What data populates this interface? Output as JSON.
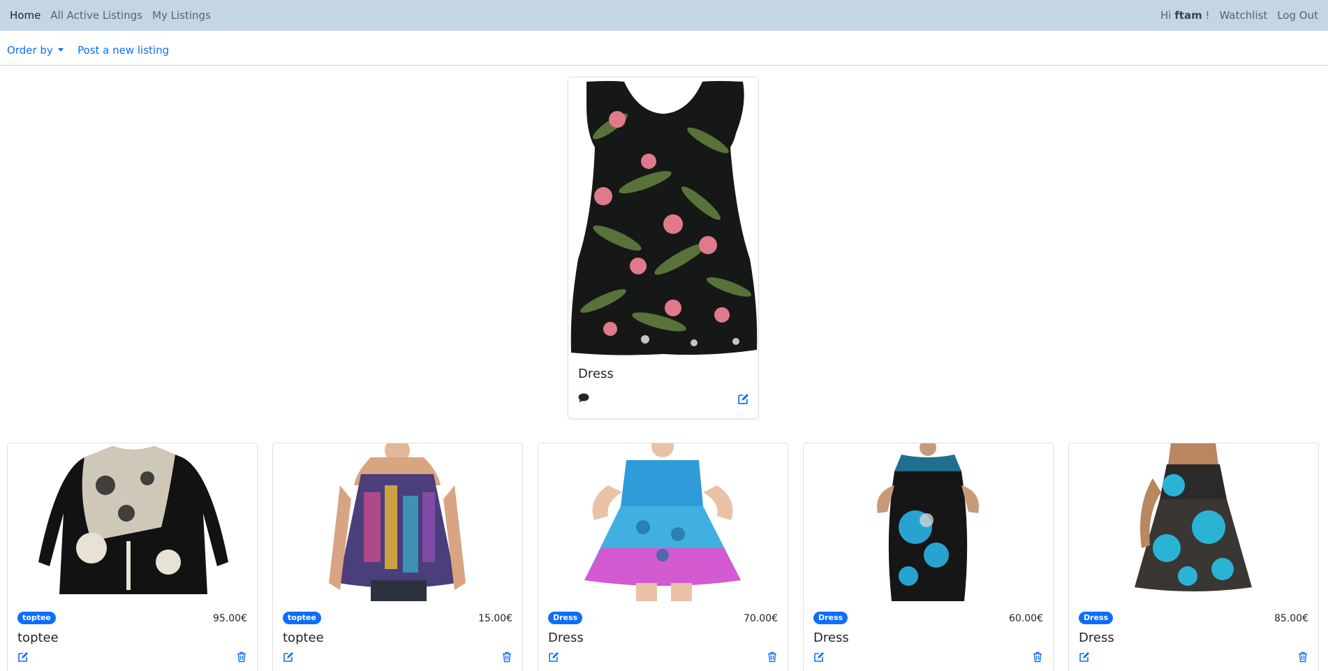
{
  "nav": {
    "home": "Home",
    "all_active": "All Active Listings",
    "my_listings": "My Listings",
    "greeting_prefix": "Hi",
    "username": "ftam",
    "greeting_suffix": "!",
    "watchlist": "Watchlist",
    "logout": "Log Out"
  },
  "toolbar": {
    "order_by": "Order by",
    "post_new": "Post a new listing"
  },
  "featured": {
    "title": "Dress",
    "chat_icon": "comment-icon",
    "edit_icon": "edit-icon"
  },
  "listings": [
    {
      "category": "toptee",
      "price": "95.00€",
      "title": "toptee"
    },
    {
      "category": "toptee",
      "price": "15.00€",
      "title": "toptee"
    },
    {
      "category": "Dress",
      "price": "70.00€",
      "title": "Dress"
    },
    {
      "category": "Dress",
      "price": "60.00€",
      "title": "Dress"
    },
    {
      "category": "Dress",
      "price": "85.00€",
      "title": "Dress"
    }
  ],
  "colors": {
    "navbar_bg": "#c4d5e4",
    "link_blue": "#0d6efd",
    "badge_blue": "#0d6efd"
  }
}
